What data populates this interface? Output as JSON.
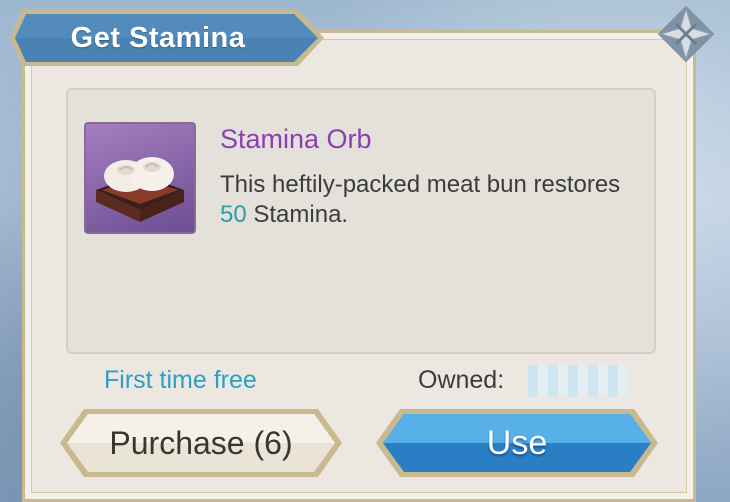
{
  "dialog": {
    "title": "Get Stamina",
    "item": {
      "name": "Stamina Orb",
      "description_part1": "This heftily-packed meat bun restores ",
      "description_amount": "50",
      "description_part2": " Stamina."
    },
    "free_text": "First time free",
    "owned_label": "Owned:",
    "owned_value": "",
    "purchase_label": "Purchase (6)",
    "use_label": "Use"
  },
  "colors": {
    "title_tab": "#4a82b3",
    "item_name": "#8b3fb5",
    "amount_highlight": "#2e9aa9",
    "free_text": "#2f9fc0",
    "use_button": "#2f8fd0",
    "purchase_button": "#e8e2d6"
  },
  "icons": {
    "close": "close-star-icon",
    "item": "meat-bun-icon"
  }
}
